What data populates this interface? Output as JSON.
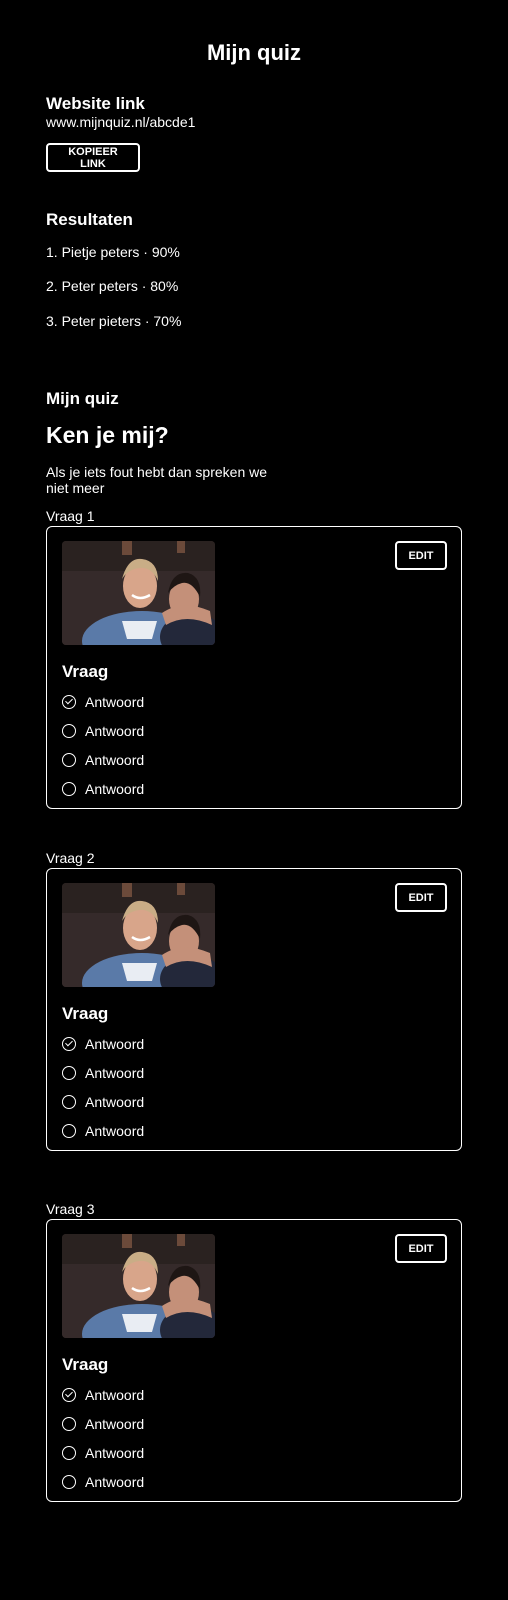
{
  "header": {
    "title": "Mijn quiz"
  },
  "website": {
    "heading": "Website link",
    "url": "www.mijnquiz.nl/abcde1",
    "copy_label": "KOPIEER LINK"
  },
  "results": {
    "heading": "Resultaten",
    "items": [
      "1. Pietje peters · 90%",
      "2. Peter peters · 80%",
      "3. Peter pieters · 70%"
    ]
  },
  "quiz": {
    "heading": "Mijn quiz",
    "title": "Ken je mij?",
    "description": "Als je iets fout hebt dan spreken we niet meer",
    "edit_label": "EDIT",
    "questions": [
      {
        "label": "Vraag 1",
        "title": "Vraag",
        "answers": [
          "Antwoord",
          "Antwoord",
          "Antwoord",
          "Antwoord"
        ],
        "correct_index": 0
      },
      {
        "label": "Vraag 2",
        "title": "Vraag",
        "answers": [
          "Antwoord",
          "Antwoord",
          "Antwoord",
          "Antwoord"
        ],
        "correct_index": 0
      },
      {
        "label": "Vraag 3",
        "title": "Vraag",
        "answers": [
          "Antwoord",
          "Antwoord",
          "Antwoord",
          "Antwoord"
        ],
        "correct_index": 0
      }
    ]
  },
  "colors": {
    "background": "#000000",
    "foreground": "#ffffff"
  }
}
